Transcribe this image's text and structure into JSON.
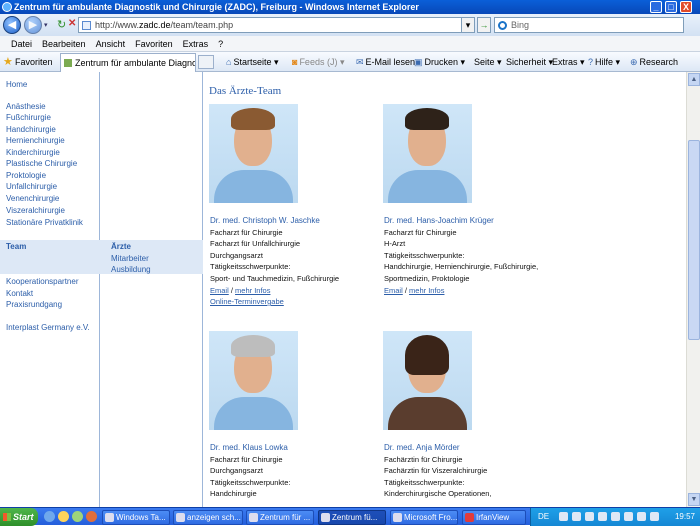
{
  "window": {
    "title": "Zentrum für ambulante Diagnostik und Chirurgie (ZADC), Freiburg - Windows Internet Explorer",
    "buttons": {
      "minimize": "_",
      "maximize": "□",
      "close": "X"
    }
  },
  "address_bar": {
    "url_prefix": "http://www.",
    "url_domain": "zadc.de",
    "url_path": "/team/team.php",
    "search_placeholder": "Bing"
  },
  "menu": [
    "Datei",
    "Bearbeiten",
    "Ansicht",
    "Favoriten",
    "Extras",
    "?"
  ],
  "command_bar": {
    "favorites_label": "Favoriten",
    "tab_title": "Zentrum für ambulante Diagnosti...",
    "startseite": "Startseite",
    "feeds": "Feeds (J)",
    "email": "E-Mail lesen",
    "drucken": "Drucken",
    "seite": "Seite",
    "sicherheit": "Sicherheit",
    "extras": "Extras",
    "hilfe": "Hilfe",
    "research": "Research"
  },
  "left_nav": {
    "home": "Home",
    "items": [
      "Anästhesie",
      "Fußchirurgie",
      "Handchirurgie",
      "Hernienchirurgie",
      "Kinderchirurgie",
      "Plastische Chirurgie",
      "Proktologie",
      "Unfallchirurgie",
      "Venenchirurgie",
      "Viszeralchirurgie",
      "Stationäre Privatklinik"
    ],
    "team": "Team",
    "items2": [
      "Kooperationspartner",
      "Kontakt",
      "Praxisrundgang"
    ],
    "interplast": "Interplast Germany e.V."
  },
  "sub_nav": {
    "active": "Ärzte",
    "items": [
      "Mitarbeiter",
      "Ausbildung"
    ]
  },
  "page": {
    "title": "Das Ärzte-Team",
    "doctors": [
      {
        "name": "Dr. med. Christoph W. Jaschke",
        "lines": [
          "Facharzt für Chirurgie",
          "Facharzt für Unfallchirurgie",
          "Durchgangsarzt",
          "Tätigkeitsschwerpunkte:",
          "Sport- und Tauchmedizin, Fußchirurgie"
        ],
        "email": "Email",
        "sep": " / ",
        "more": "mehr Infos",
        "extra_link": "Online-Terminvergabe"
      },
      {
        "name": "Dr. med. Hans-Joachim Krüger",
        "lines": [
          "Facharzt für Chirurgie",
          "H-Arzt",
          "Tätigkeitsschwerpunkte:",
          "Handchirurgie, Hernienchirurgie, Fußchirurgie,",
          "Sportmedizin, Proktologie"
        ],
        "email": "Email",
        "sep": " / ",
        "more": "mehr Infos"
      },
      {
        "name": "Dr. med. Klaus Lowka",
        "lines": [
          "Facharzt für Chirurgie",
          "Durchgangsarzt",
          "Tätigkeitsschwerpunkte:",
          "Handchirurgie"
        ]
      },
      {
        "name": "Dr. med. Anja Mörder",
        "lines": [
          "Fachärztin für Chirurgie",
          "Fachärztin für Viszeralchirurgie",
          "Tätigkeitsschwerpunkte:",
          "Kinderchirurgische Operationen,"
        ]
      }
    ]
  },
  "taskbar": {
    "start": "Start",
    "tasks": [
      "Windows Ta...",
      "anzeigen sch...",
      "Zentrum für ...",
      "Zentrum fü...",
      "Microsoft Fro...",
      "IrfanView"
    ],
    "lang": "DE",
    "clock": "19:57"
  },
  "colors": {
    "link": "#2c5ea9",
    "nav_highlight": "#dde8f6",
    "titlebar": "#0a5fd8",
    "taskbar": "#245edb",
    "start": "#2e8f2a"
  }
}
